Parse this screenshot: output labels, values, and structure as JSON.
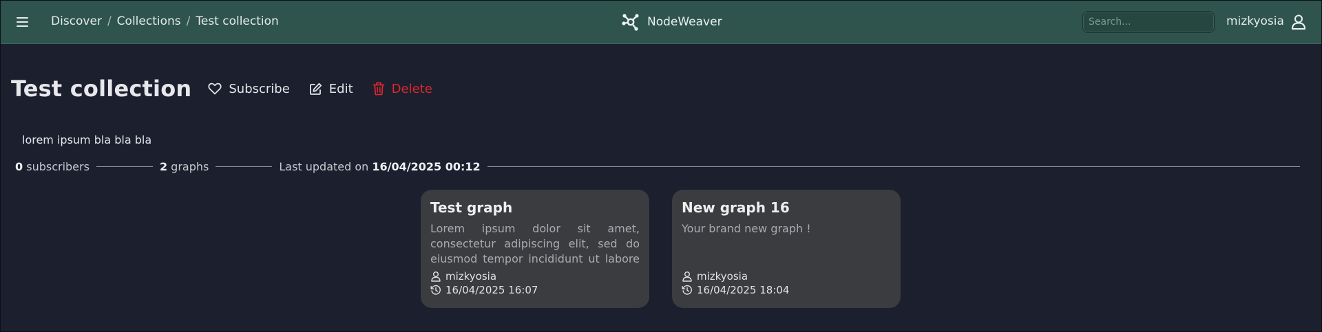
{
  "topbar": {
    "breadcrumb": [
      "Discover",
      "Collections",
      "Test collection"
    ],
    "brand": "NodeWeaver",
    "search_placeholder": "Search...",
    "username": "mizkyosia"
  },
  "header": {
    "title": "Test collection",
    "subscribe_label": "Subscribe",
    "edit_label": "Edit",
    "delete_label": "Delete"
  },
  "description": "lorem ipsum bla bla bla",
  "stats": {
    "subscribers_count": "0",
    "subscribers_label": "subscribers",
    "graphs_count": "2",
    "graphs_label": "graphs",
    "updated_label": "Last updated on",
    "updated_value": "16/04/2025 00:12"
  },
  "graphs": [
    {
      "title": "Test graph",
      "description": "Lorem ipsum dolor sit amet, consectetur adipiscing elit, sed do eiusmod tempor incididunt ut labore ...",
      "author": "mizkyosia",
      "date": "16/04/2025 16:07"
    },
    {
      "title": "New graph 16",
      "description": "Your brand new graph !",
      "author": "mizkyosia",
      "date": "16/04/2025 18:04"
    }
  ],
  "colors": {
    "topbar": "#2f544e",
    "background": "#1b1f2e",
    "card": "#3a3c40",
    "delete": "#e0262d"
  },
  "icons": [
    "menu-icon",
    "nodeweaver-logo-icon",
    "user-icon",
    "heart-icon",
    "edit-icon",
    "trash-icon",
    "author-icon",
    "history-icon"
  ]
}
